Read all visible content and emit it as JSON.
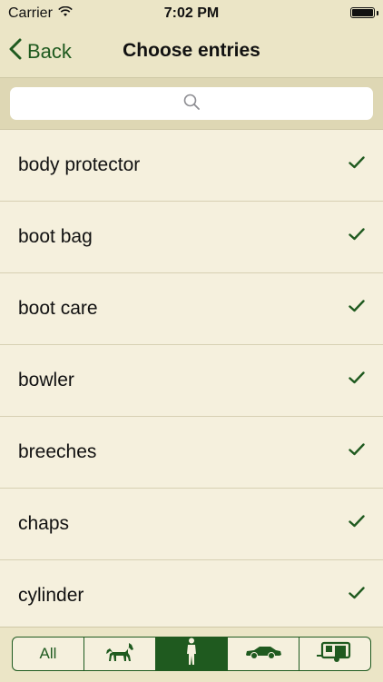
{
  "status_bar": {
    "carrier": "Carrier",
    "time": "7:02 PM"
  },
  "nav": {
    "back_label": "Back",
    "title": "Choose entries"
  },
  "search": {
    "placeholder": ""
  },
  "entries": [
    {
      "label": "body protector",
      "checked": true
    },
    {
      "label": "boot bag",
      "checked": true
    },
    {
      "label": "boot care",
      "checked": true
    },
    {
      "label": "bowler",
      "checked": true
    },
    {
      "label": "breeches",
      "checked": true
    },
    {
      "label": "chaps",
      "checked": true
    },
    {
      "label": "cylinder",
      "checked": true
    }
  ],
  "tabs": {
    "all_label": "All",
    "icons": [
      "horse-icon",
      "rider-icon",
      "car-icon",
      "trailer-icon"
    ],
    "active_index": 2
  },
  "colors": {
    "accent": "#1f5a1f",
    "background": "#f5f0dd",
    "bar": "#ebe5c6"
  }
}
